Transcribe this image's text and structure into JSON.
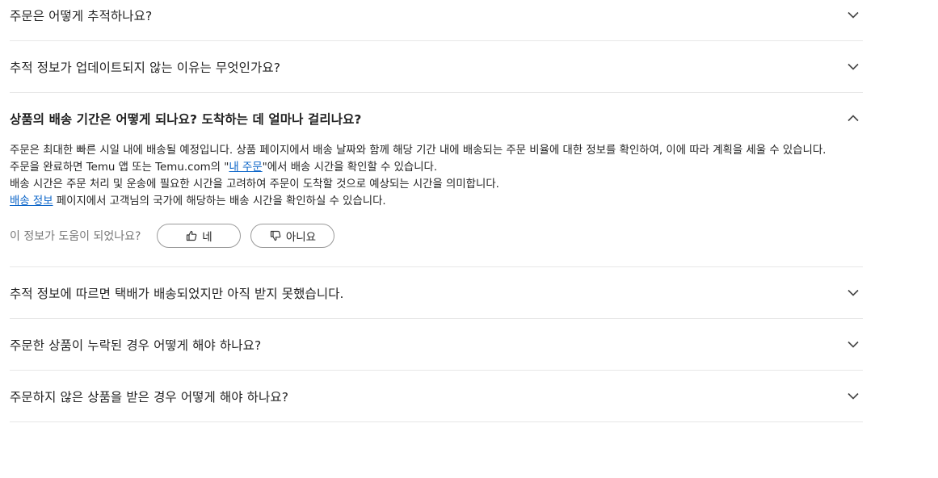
{
  "faq": {
    "items": [
      {
        "question": "주문은 어떻게 추적하나요?"
      },
      {
        "question": "추적 정보가 업데이트되지 않는 이유는 무엇인가요?"
      },
      {
        "question": "상품의 배송 기간은 어떻게 되나요? 도착하는 데 얼마나 걸리나요?"
      },
      {
        "question": "추적 정보에 따르면 택배가 배송되었지만 아직 받지 못했습니다."
      },
      {
        "question": "주문한 상품이 누락된 경우 어떻게 해야 하나요?"
      },
      {
        "question": "주문하지 않은 상품을 받은 경우 어떻게 해야 하나요?"
      }
    ],
    "answer": {
      "line1": "주문은 최대한 빠른 시일 내에 배송될 예정입니다. 상품 페이지에서 배송 날짜와 함께 해당 기간 내에 배송되는 주문 비율에 대한 정보를 확인하여, 이에 따라 계획을 세울 수 있습니다.",
      "line2_prefix": "주문을 완료하면 Temu 앱 또는 Temu.com의 \"",
      "line2_link": "내 주문",
      "line2_suffix": "\"에서 배송 시간을 확인할 수 있습니다.",
      "line3": "배송 시간은 주문 처리 및 운송에 필요한 시간을 고려하여 주문이 도착할 것으로 예상되는 시간을 의미합니다.",
      "line4_link": "배송 정보",
      "line4_suffix": " 페이지에서 고객님의 국가에 해당하는 배송 시간을 확인하실 수 있습니다."
    },
    "feedback": {
      "label": "이 정보가 도움이 되었나요?",
      "yes_label": "네",
      "no_label": "아니요"
    },
    "icons": {
      "expand": "chevron-down-icon",
      "collapse": "chevron-up-icon",
      "yes": "thumbs-up-icon",
      "no": "thumbs-down-icon"
    }
  }
}
